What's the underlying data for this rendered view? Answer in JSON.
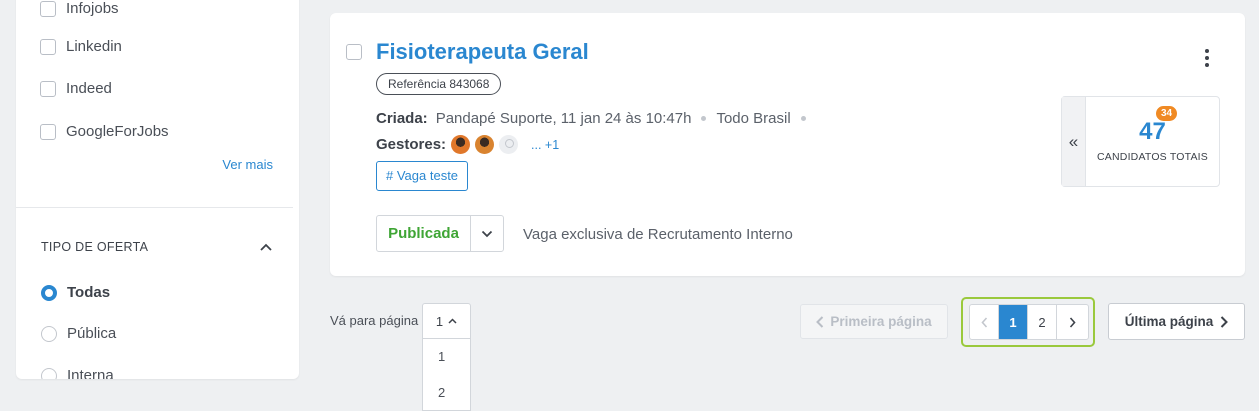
{
  "sidebar": {
    "sources": [
      {
        "label": "Infojobs",
        "checked": false
      },
      {
        "label": "Linkedin",
        "checked": false
      },
      {
        "label": "Indeed",
        "checked": false
      },
      {
        "label": "GoogleForJobs",
        "checked": false
      }
    ],
    "see_more": "Ver mais",
    "offer_type": {
      "title": "TIPO DE OFERTA",
      "options": [
        {
          "label": "Todas",
          "selected": true
        },
        {
          "label": "Pública",
          "selected": false
        },
        {
          "label": "Interna",
          "selected": false
        }
      ]
    }
  },
  "job": {
    "title": "Fisioterapeuta Geral",
    "reference": "Referência 843068",
    "created_label": "Criada:",
    "created_value": "Pandapé Suporte, 11 jan 24 às 10:47h",
    "location": "Todo Brasil",
    "managers_label": "Gestores:",
    "managers_more": "... +1",
    "tag": "# Vaga teste",
    "status": "Publicada",
    "status_note": "Vaga exclusiva de Recrutamento Interno",
    "candidates": {
      "total": "47",
      "new_badge": "34",
      "label": "CANDIDATOS TOTAIS",
      "collapse_glyph": "«"
    }
  },
  "pagination": {
    "goto_label": "Vá para página",
    "goto_selected": "1",
    "goto_options": [
      "1",
      "2"
    ],
    "first_label": "Primeira página",
    "pages": [
      "1",
      "2"
    ],
    "current_page": "1",
    "last_label": "Última página"
  },
  "colors": {
    "accent": "#2a87d0",
    "published": "#3fa535",
    "badge": "#f08a24",
    "focus_ring": "#9ac93d"
  }
}
